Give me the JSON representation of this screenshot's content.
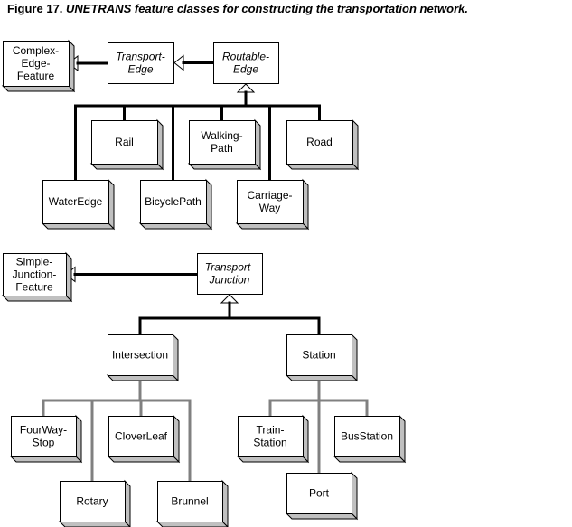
{
  "caption": {
    "prefix": "Figure 17. ",
    "title": "UNETRANS feature classes for constructing the transportation network."
  },
  "colors": {
    "line": "#000000",
    "gray_line": "#808080",
    "shadow": "#c0c0c0",
    "box_fill": "#ffffff"
  },
  "nodes": [
    {
      "id": "complex-edge-feature",
      "lines": [
        "Complex-",
        "Edge-",
        "Feature"
      ],
      "italic": false,
      "shadow": true
    },
    {
      "id": "transport-edge",
      "lines": [
        "Transport-",
        "Edge"
      ],
      "italic": true,
      "shadow": false
    },
    {
      "id": "routable-edge",
      "lines": [
        "Routable-",
        "Edge"
      ],
      "italic": true,
      "shadow": false
    },
    {
      "id": "rail",
      "lines": [
        "Rail"
      ],
      "italic": false,
      "shadow": true
    },
    {
      "id": "walking-path",
      "lines": [
        "Walking-",
        "Path"
      ],
      "italic": false,
      "shadow": true
    },
    {
      "id": "road",
      "lines": [
        "Road"
      ],
      "italic": false,
      "shadow": true
    },
    {
      "id": "water-edge",
      "lines": [
        "WaterEdge"
      ],
      "italic": false,
      "shadow": true
    },
    {
      "id": "bicycle-path",
      "lines": [
        "BicyclePath"
      ],
      "italic": false,
      "shadow": true
    },
    {
      "id": "carriage-way",
      "lines": [
        "Carriage-",
        "Way"
      ],
      "italic": false,
      "shadow": true
    },
    {
      "id": "simple-junction-feature",
      "lines": [
        "Simple-",
        "Junction-",
        "Feature"
      ],
      "italic": false,
      "shadow": true
    },
    {
      "id": "transport-junction",
      "lines": [
        "Transport-",
        "Junction"
      ],
      "italic": true,
      "shadow": false
    },
    {
      "id": "intersection",
      "lines": [
        "Intersection"
      ],
      "italic": false,
      "shadow": true
    },
    {
      "id": "station",
      "lines": [
        "Station"
      ],
      "italic": false,
      "shadow": true
    },
    {
      "id": "four-way-stop",
      "lines": [
        "FourWay-",
        "Stop"
      ],
      "italic": false,
      "shadow": true
    },
    {
      "id": "clover-leaf",
      "lines": [
        "CloverLeaf"
      ],
      "italic": false,
      "shadow": true
    },
    {
      "id": "rotary",
      "lines": [
        "Rotary"
      ],
      "italic": false,
      "shadow": true
    },
    {
      "id": "brunnel",
      "lines": [
        "Brunnel"
      ],
      "italic": false,
      "shadow": true
    },
    {
      "id": "train-station",
      "lines": [
        "Train-",
        "Station"
      ],
      "italic": false,
      "shadow": true
    },
    {
      "id": "bus-station",
      "lines": [
        "BusStation"
      ],
      "italic": false,
      "shadow": true
    },
    {
      "id": "port",
      "lines": [
        "Port"
      ],
      "italic": false,
      "shadow": true
    }
  ],
  "relations": [
    {
      "type": "inheritance",
      "parent": "complex-edge-feature",
      "children": [
        "transport-edge"
      ]
    },
    {
      "type": "inheritance",
      "parent": "transport-edge",
      "children": [
        "routable-edge"
      ]
    },
    {
      "type": "inheritance",
      "parent": "routable-edge",
      "children": [
        "water-edge",
        "rail",
        "bicycle-path",
        "walking-path",
        "carriage-way",
        "road"
      ]
    },
    {
      "type": "inheritance",
      "parent": "simple-junction-feature",
      "children": [
        "transport-junction"
      ]
    },
    {
      "type": "inheritance",
      "parent": "transport-junction",
      "children": [
        "intersection",
        "station"
      ]
    },
    {
      "type": "subtype",
      "parent": "intersection",
      "children": [
        "four-way-stop",
        "rotary",
        "clover-leaf",
        "brunnel"
      ]
    },
    {
      "type": "subtype",
      "parent": "station",
      "children": [
        "train-station",
        "port",
        "bus-station"
      ]
    }
  ]
}
